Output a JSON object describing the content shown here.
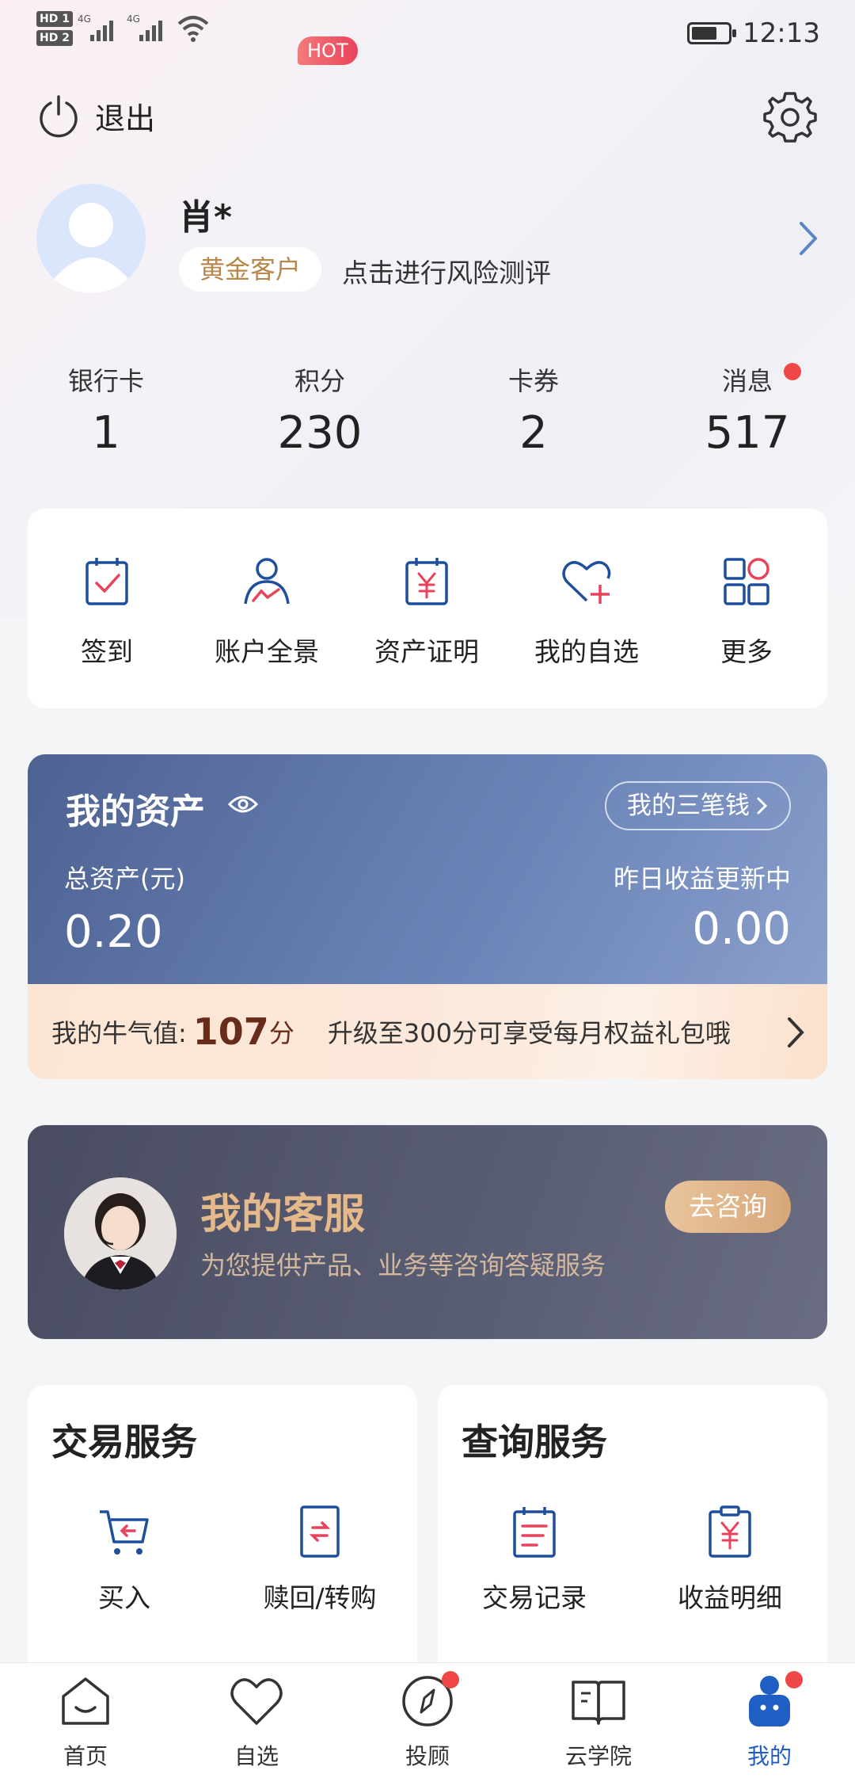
{
  "status_bar": {
    "hd1": "HD 1",
    "hd2": "HD 2",
    "net1": "4G",
    "net2": "4G",
    "time": "12:13",
    "battery_level": 0.7
  },
  "top": {
    "logout_label": "退出"
  },
  "profile": {
    "name": "肖*",
    "level": "黄金客户",
    "risk_link": "点击进行风险测评"
  },
  "stats": [
    {
      "label": "银行卡",
      "value": "1"
    },
    {
      "label": "积分",
      "value": "230"
    },
    {
      "label": "卡券",
      "value": "2"
    },
    {
      "label": "消息",
      "value": "517"
    }
  ],
  "quick_actions": [
    {
      "label": "签到",
      "icon": "calendar-check-icon"
    },
    {
      "label": "账户全景",
      "icon": "user-chart-icon"
    },
    {
      "label": "资产证明",
      "icon": "calendar-yuan-icon"
    },
    {
      "label": "我的自选",
      "icon": "heart-plus-icon"
    },
    {
      "label": "更多",
      "icon": "grid-icon"
    }
  ],
  "hot_badge": "HOT",
  "assets": {
    "title": "我的资产",
    "three_money": "我的三笔钱",
    "total_label": "总资产(元)",
    "total_value": "0.20",
    "yesterday_label": "昨日收益更新中",
    "yesterday_value": "0.00"
  },
  "bull": {
    "label": "我的牛气值:",
    "score": "107",
    "unit": "分",
    "tip": "升级至300分可享受每月权益礼包哦"
  },
  "service": {
    "title": "我的客服",
    "desc": "为您提供产品、业务等咨询答疑服务",
    "button": "去咨询"
  },
  "trade_services": {
    "title": "交易服务",
    "items": [
      {
        "label": "买入",
        "icon": "cart-icon"
      },
      {
        "label": "赎回/转购",
        "icon": "redeem-icon"
      }
    ]
  },
  "query_services": {
    "title": "查询服务",
    "items": [
      {
        "label": "交易记录",
        "icon": "record-icon"
      },
      {
        "label": "收益明细",
        "icon": "income-icon"
      }
    ]
  },
  "bottom_nav": [
    {
      "label": "首页",
      "icon": "home-icon"
    },
    {
      "label": "自选",
      "icon": "heart-icon"
    },
    {
      "label": "投顾",
      "icon": "compass-icon"
    },
    {
      "label": "云学院",
      "icon": "book-icon"
    },
    {
      "label": "我的",
      "icon": "profile-icon"
    }
  ],
  "colors": {
    "accent_blue": "#1f5fc4",
    "accent_red": "#e8435a",
    "gold": "#b9874b"
  }
}
